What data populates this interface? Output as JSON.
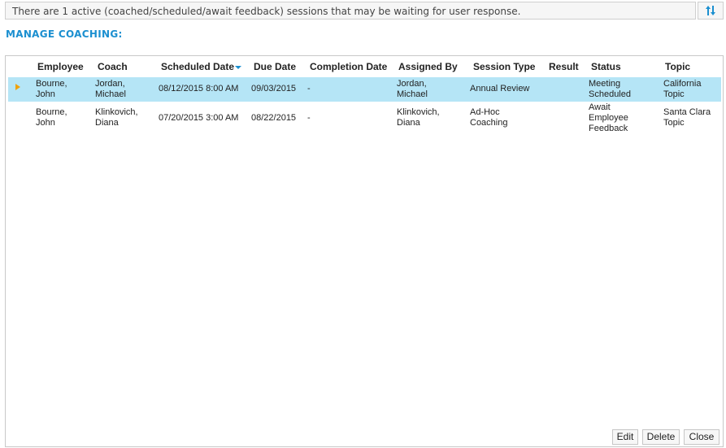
{
  "banner": {
    "message": "There are 1 active (coached/scheduled/await feedback) sessions that may be waiting for user response."
  },
  "toolbar": {
    "sort_icon": "sort-arrows-icon"
  },
  "section": {
    "title": "MANAGE COACHING:"
  },
  "grid": {
    "columns": [
      "Employee",
      "Coach",
      "Scheduled Date",
      "Due Date",
      "Completion Date",
      "Assigned By",
      "Session Type",
      "Result",
      "Status",
      "Topic"
    ],
    "sorted_column": "Scheduled Date",
    "sort_direction": "descending",
    "rows": [
      {
        "selected": true,
        "employee": [
          "Bourne,",
          "John"
        ],
        "coach": [
          "Jordan,",
          "Michael"
        ],
        "scheduled_date": "08/12/2015 8:00 AM",
        "due_date": "09/03/2015",
        "completion_date": "-",
        "assigned_by": [
          "Jordan,",
          "Michael"
        ],
        "session_type": [
          "Annual Review"
        ],
        "result": "",
        "status": [
          "Meeting",
          "Scheduled"
        ],
        "topic": [
          "California",
          "Topic"
        ]
      },
      {
        "selected": false,
        "employee": [
          "Bourne,",
          "John"
        ],
        "coach": [
          "Klinkovich,",
          "Diana"
        ],
        "scheduled_date": "07/20/2015 3:00 AM",
        "due_date": "08/22/2015",
        "completion_date": "-",
        "assigned_by": [
          "Klinkovich,",
          "Diana"
        ],
        "session_type": [
          "Ad-Hoc",
          "Coaching"
        ],
        "result": "",
        "status": [
          "Await",
          "Employee",
          "Feedback"
        ],
        "topic": [
          "Santa Clara",
          "Topic"
        ]
      }
    ]
  },
  "buttons": {
    "edit": "Edit",
    "delete": "Delete",
    "close": "Close"
  },
  "colors": {
    "accent": "#1b8fd0",
    "selected_row": "#b5e5f6",
    "row_marker": "#f0a20a"
  }
}
